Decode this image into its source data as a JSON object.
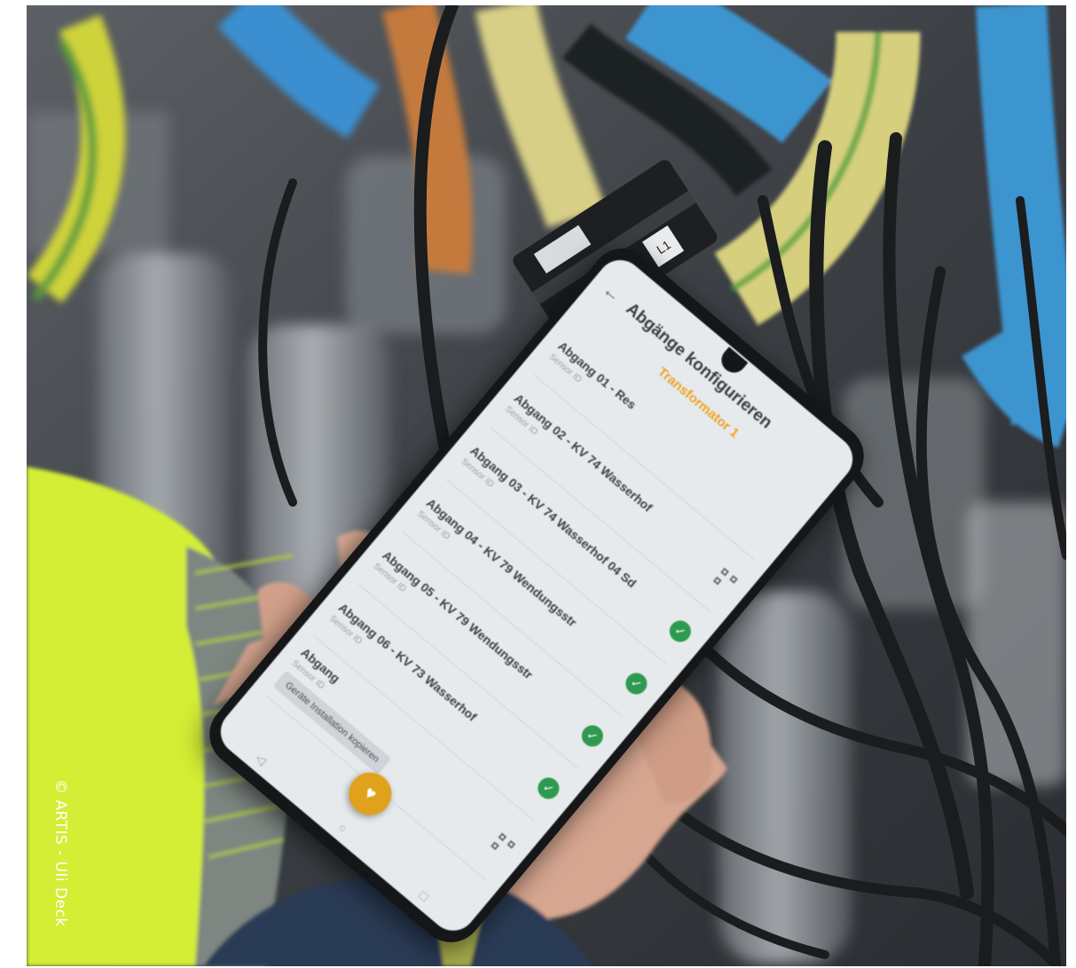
{
  "photo": {
    "credit": "© ARTIS - Uli Deck",
    "colors": {
      "cable_blue": "#3d95d0",
      "cable_orange": "#c8783d",
      "cable_yellow": "#d7cf82",
      "cable_green_yellow": "#a8c43a",
      "hi_vis_jacket": "#d8f03a",
      "app_accent": "#f0a223",
      "check_green": "#2e9a4f"
    }
  },
  "sensor": {
    "label": "L1"
  },
  "phone_app": {
    "title": "Abgänge konfigurieren",
    "station": "Transformator 1",
    "items": [
      {
        "title": "Abgang 01 - Res",
        "subtitle": "Sensor ID",
        "status": "none"
      },
      {
        "title": "Abgang 02 - KV 74 Wasserhof",
        "subtitle": "Sensor ID",
        "status": "qr"
      },
      {
        "title": "Abgang 03 - KV 74 Wasserhof 04 Sd",
        "subtitle": "Sensor ID",
        "status": "check"
      },
      {
        "title": "Abgang 04 - KV 79 Wendungsstr",
        "subtitle": "Sensor ID",
        "status": "check"
      },
      {
        "title": "Abgang 05 - KV 79 Wendungsstr",
        "subtitle": "Sensor ID",
        "status": "check"
      },
      {
        "title": "Abgang 06 - KV 73 Wasserhof",
        "subtitle": "Sensor ID",
        "status": "check"
      },
      {
        "title": "Abgang",
        "subtitle": "Sensor ID",
        "status": "qr",
        "chip": "Geräte Installation kopieren"
      }
    ]
  }
}
